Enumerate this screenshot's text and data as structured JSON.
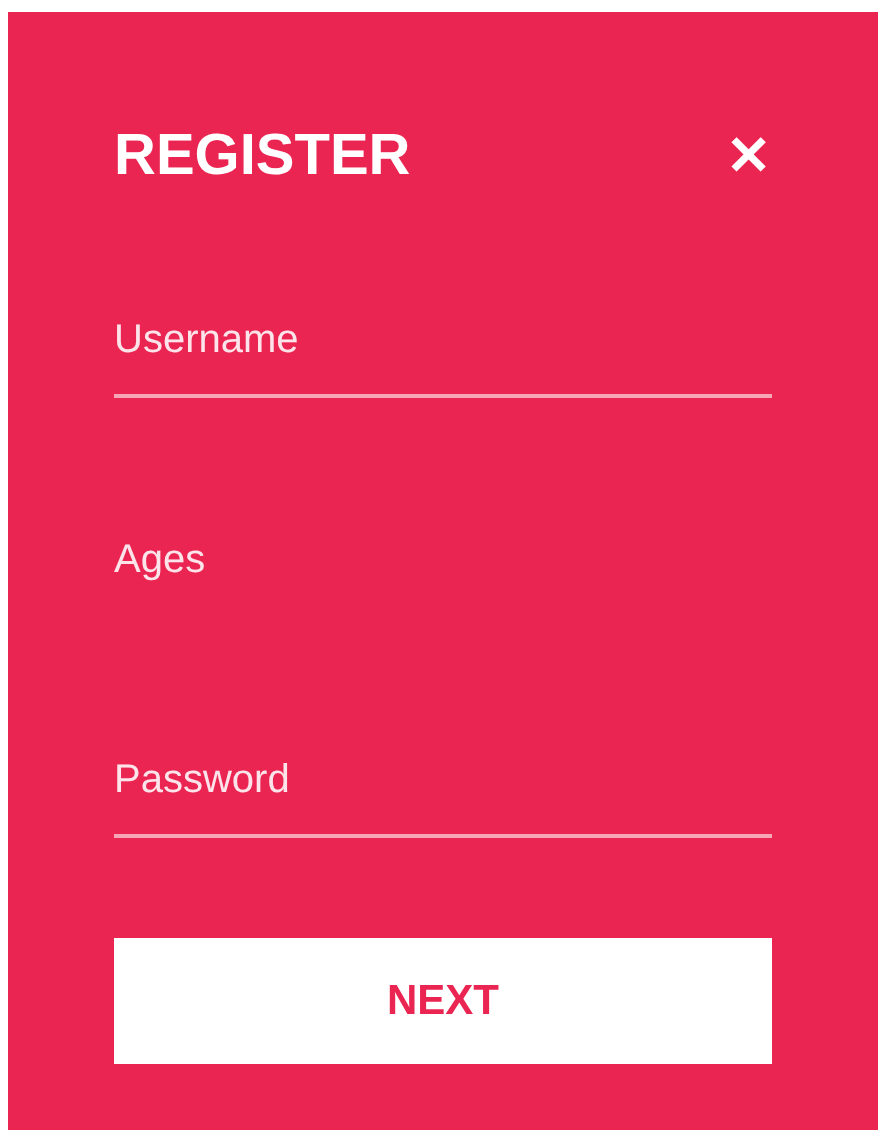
{
  "form": {
    "title": "REGISTER",
    "close": "✕",
    "fields": [
      {
        "placeholder": "Username",
        "underline": true
      },
      {
        "placeholder": "Ages",
        "underline": false
      },
      {
        "placeholder": "Password",
        "underline": true
      }
    ],
    "button": "NEXT"
  }
}
